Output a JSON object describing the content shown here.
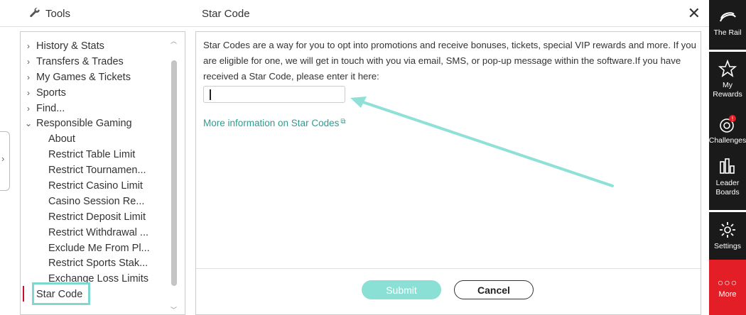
{
  "tools": {
    "title": "Tools"
  },
  "sidebar": {
    "items": [
      {
        "label": "History & Stats",
        "chevron": "›"
      },
      {
        "label": "Transfers & Trades",
        "chevron": "›"
      },
      {
        "label": "My Games & Tickets",
        "chevron": "›"
      },
      {
        "label": "Sports",
        "chevron": "›"
      },
      {
        "label": "Find...",
        "chevron": "›"
      },
      {
        "label": "Responsible Gaming",
        "chevron": "⌄"
      },
      {
        "label": "About"
      },
      {
        "label": "Restrict Table Limit"
      },
      {
        "label": "Restrict Tournamen..."
      },
      {
        "label": "Restrict Casino Limit"
      },
      {
        "label": "Casino Session Re..."
      },
      {
        "label": "Restrict Deposit Limit"
      },
      {
        "label": "Restrict Withdrawal ..."
      },
      {
        "label": "Exclude Me From Pl..."
      },
      {
        "label": "Restrict Sports Stak..."
      },
      {
        "label": "Exchange Loss Limits"
      },
      {
        "label": "Star Code"
      }
    ]
  },
  "dialog": {
    "title": "Star Code",
    "description": "Star Codes are a way for you to opt into promotions and receive bonuses, tickets, special VIP rewards and more. If you are eligible for one, we will get in touch with you via email, SMS, or pop-up message within the software.If you have received a Star Code, please enter it here:",
    "input_value": "",
    "more_info_link": "More information on Star Codes",
    "submit_label": "Submit",
    "cancel_label": "Cancel"
  },
  "rail": {
    "the_rail": "The Rail",
    "my_rewards": "My Rewards",
    "challenges": "Challenges",
    "leader_boards": "Leader Boards",
    "settings": "Settings",
    "more": "More",
    "challenges_badge": "!"
  },
  "colors": {
    "accent_teal": "#2a9d8f",
    "rail_red": "#e41e26",
    "rail_bg": "#1a1a1a"
  }
}
